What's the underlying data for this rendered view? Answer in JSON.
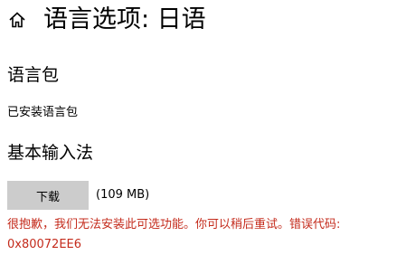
{
  "header": {
    "home_icon": "home-icon",
    "title": "语言选项: 日语"
  },
  "language_pack": {
    "heading": "语言包",
    "status": "已安装语言包"
  },
  "input_method": {
    "heading": "基本输入法",
    "download_label": "下载",
    "size": "(109 MB)"
  },
  "error": {
    "message": "很抱歉，我们无法安装此可选功能。你可以稍后重试。错误代码:",
    "code": "0x80072EE6",
    "color": "#c42b1c"
  },
  "colors": {
    "button_bg": "#cccccc",
    "text": "#000000"
  }
}
